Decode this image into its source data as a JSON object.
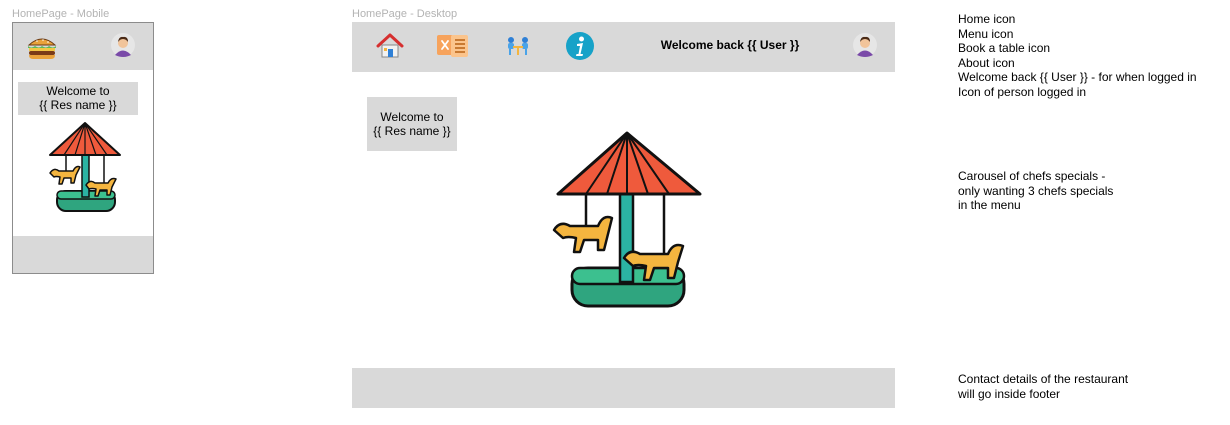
{
  "mobile": {
    "frame_label": "HomePage - Mobile",
    "welcome_line1": "Welcome to",
    "welcome_line2": "{{ Res name }}"
  },
  "desktop": {
    "frame_label": "HomePage - Desktop",
    "welcome_user": "Welcome back {{ User }}",
    "welcome_line1": "Welcome to",
    "welcome_line2": "{{ Res name }}"
  },
  "icons": {
    "mobile_header": [
      "burger-icon",
      "user-avatar-icon"
    ],
    "desktop_header": [
      "home-icon",
      "menu-icon",
      "book-table-icon",
      "about-icon",
      "user-avatar-icon"
    ],
    "carousel": "carousel-icon"
  },
  "notes": {
    "nav": [
      "Home icon",
      "Menu icon",
      "Book a table icon",
      "About icon",
      "Welcome back {{ User }} - for when logged in",
      "Icon of person logged in"
    ],
    "carousel": [
      "Carousel of chefs specials -",
      "only wanting 3 chefs specials",
      "in the menu"
    ],
    "footer": [
      "Contact details of the restaurant",
      "will go inside footer"
    ]
  },
  "colors": {
    "frame_fill": "#d9d9d9",
    "frame_border": "#8c8c8c",
    "about_icon": "#17a2c8",
    "canopy": "#ef5a3c",
    "horse": "#f4b53f",
    "base": "#2fa57f"
  }
}
